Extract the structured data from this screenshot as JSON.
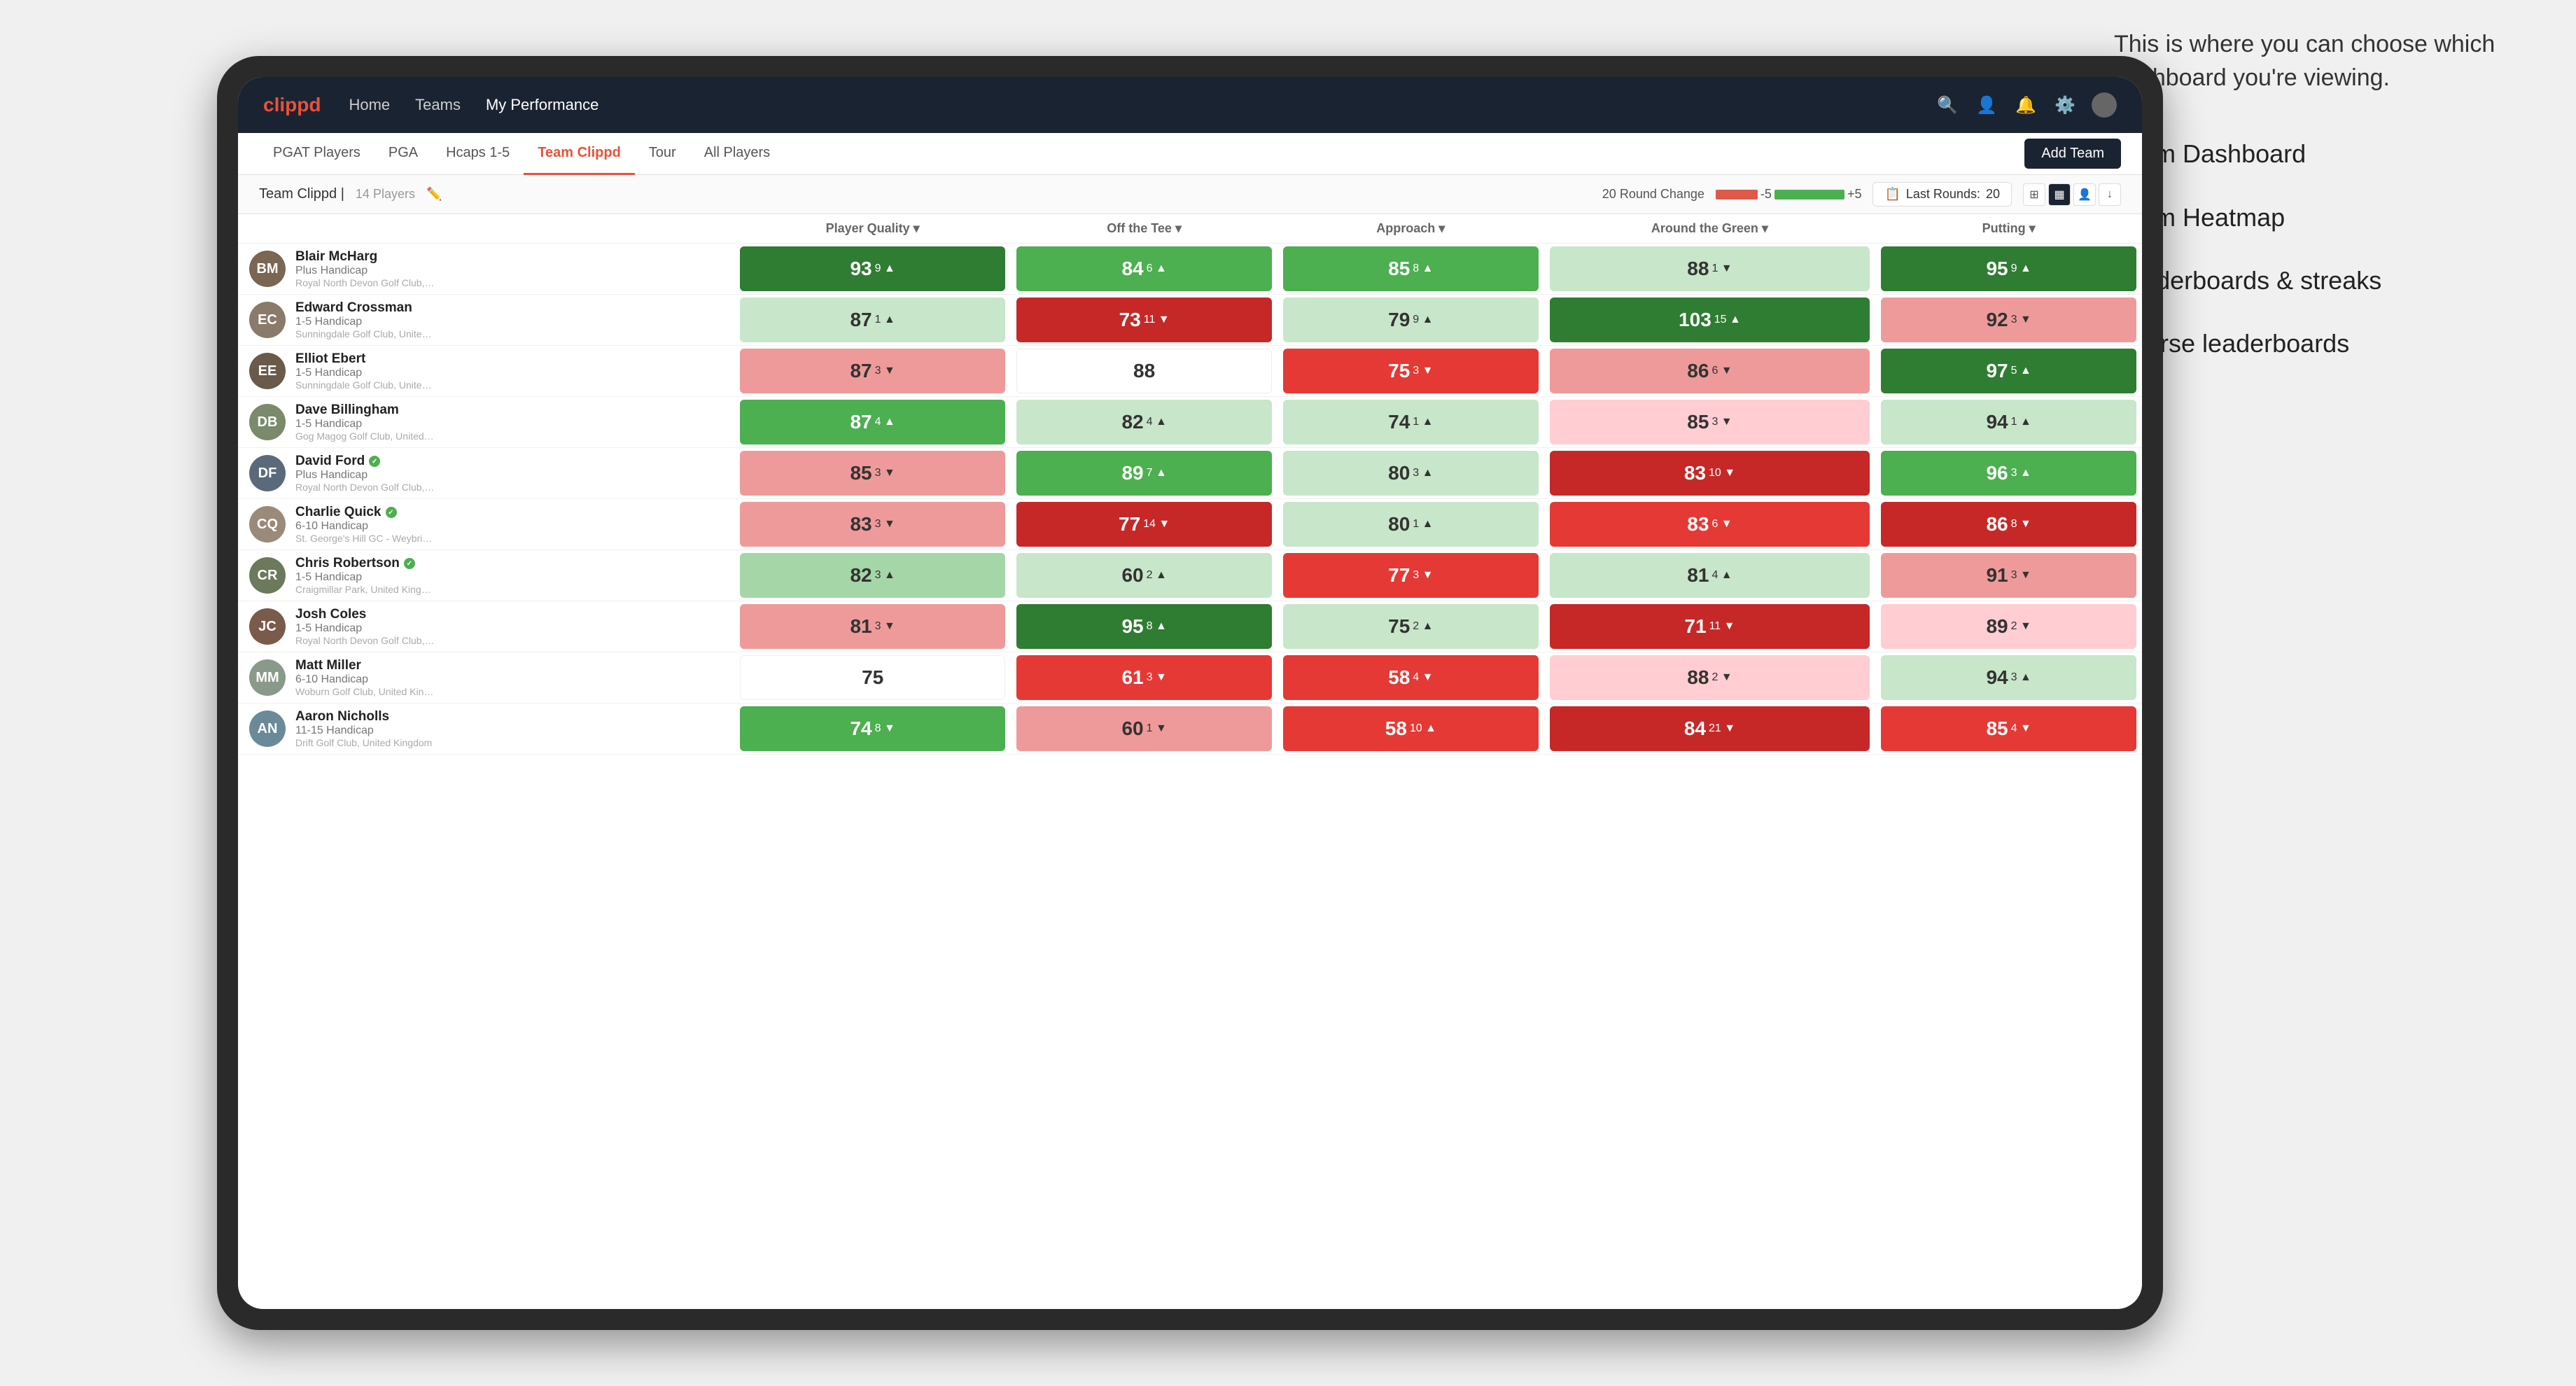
{
  "annotation": {
    "intro": "This is where you can choose which dashboard you're viewing.",
    "items": [
      "Team Dashboard",
      "Team Heatmap",
      "Leaderboards & streaks",
      "Course leaderboards"
    ]
  },
  "nav": {
    "logo": "clippd",
    "links": [
      "Home",
      "Teams",
      "My Performance"
    ],
    "active_link": "My Performance"
  },
  "tabs": {
    "items": [
      "PGAT Players",
      "PGA",
      "Hcaps 1-5",
      "Team Clippd",
      "Tour",
      "All Players"
    ],
    "active": "Team Clippd",
    "add_button": "Add Team"
  },
  "sub_header": {
    "title": "Team Clippd",
    "player_count": "14 Players",
    "round_change_label": "20 Round Change",
    "round_change_minus": "-5",
    "round_change_plus": "+5",
    "last_rounds_label": "Last Rounds:",
    "last_rounds_value": "20"
  },
  "table": {
    "columns": [
      "Player Quality ▾",
      "Off the Tee ▾",
      "Approach ▾",
      "Around the Green ▾",
      "Putting ▾"
    ],
    "rows": [
      {
        "name": "Blair McHarg",
        "handicap": "Plus Handicap",
        "club": "Royal North Devon Golf Club, United Kingdom",
        "avatar_initials": "BM",
        "avatar_color": "#7a6652",
        "metrics": [
          {
            "value": "93",
            "change": "9",
            "dir": "up",
            "bg": "bg-green-dark"
          },
          {
            "value": "84",
            "change": "6",
            "dir": "up",
            "bg": "bg-green-mid"
          },
          {
            "value": "85",
            "change": "8",
            "dir": "up",
            "bg": "bg-green-mid"
          },
          {
            "value": "88",
            "change": "1",
            "dir": "down",
            "bg": "bg-light-green"
          },
          {
            "value": "95",
            "change": "9",
            "dir": "up",
            "bg": "bg-green-dark"
          }
        ]
      },
      {
        "name": "Edward Crossman",
        "handicap": "1-5 Handicap",
        "club": "Sunningdale Golf Club, United Kingdom",
        "avatar_initials": "EC",
        "avatar_color": "#8a7a6a",
        "metrics": [
          {
            "value": "87",
            "change": "1",
            "dir": "up",
            "bg": "bg-light-green"
          },
          {
            "value": "73",
            "change": "11",
            "dir": "down",
            "bg": "bg-red-dark"
          },
          {
            "value": "79",
            "change": "9",
            "dir": "up",
            "bg": "bg-light-green"
          },
          {
            "value": "103",
            "change": "15",
            "dir": "up",
            "bg": "bg-green-dark"
          },
          {
            "value": "92",
            "change": "3",
            "dir": "down",
            "bg": "bg-red-light"
          }
        ]
      },
      {
        "name": "Elliot Ebert",
        "handicap": "1-5 Handicap",
        "club": "Sunningdale Golf Club, United Kingdom",
        "avatar_initials": "EE",
        "avatar_color": "#6a5a4a",
        "metrics": [
          {
            "value": "87",
            "change": "3",
            "dir": "down",
            "bg": "bg-red-light"
          },
          {
            "value": "88",
            "change": "",
            "dir": "",
            "bg": "bg-white"
          },
          {
            "value": "75",
            "change": "3",
            "dir": "down",
            "bg": "bg-red-mid"
          },
          {
            "value": "86",
            "change": "6",
            "dir": "down",
            "bg": "bg-red-light"
          },
          {
            "value": "97",
            "change": "5",
            "dir": "up",
            "bg": "bg-green-dark"
          }
        ]
      },
      {
        "name": "Dave Billingham",
        "handicap": "1-5 Handicap",
        "club": "Gog Magog Golf Club, United Kingdom",
        "avatar_initials": "DB",
        "avatar_color": "#7a8a6a",
        "metrics": [
          {
            "value": "87",
            "change": "4",
            "dir": "up",
            "bg": "bg-green-mid"
          },
          {
            "value": "82",
            "change": "4",
            "dir": "up",
            "bg": "bg-light-green"
          },
          {
            "value": "74",
            "change": "1",
            "dir": "up",
            "bg": "bg-light-green"
          },
          {
            "value": "85",
            "change": "3",
            "dir": "down",
            "bg": "bg-light-red"
          },
          {
            "value": "94",
            "change": "1",
            "dir": "up",
            "bg": "bg-light-green"
          }
        ]
      },
      {
        "name": "David Ford",
        "handicap": "Plus Handicap",
        "club": "Royal North Devon Golf Club, United Kingdom",
        "avatar_initials": "DF",
        "avatar_color": "#5a6a7a",
        "badge": true,
        "metrics": [
          {
            "value": "85",
            "change": "3",
            "dir": "down",
            "bg": "bg-red-light"
          },
          {
            "value": "89",
            "change": "7",
            "dir": "up",
            "bg": "bg-green-mid"
          },
          {
            "value": "80",
            "change": "3",
            "dir": "up",
            "bg": "bg-light-green"
          },
          {
            "value": "83",
            "change": "10",
            "dir": "down",
            "bg": "bg-red-dark"
          },
          {
            "value": "96",
            "change": "3",
            "dir": "up",
            "bg": "bg-green-mid"
          }
        ]
      },
      {
        "name": "Charlie Quick",
        "handicap": "6-10 Handicap",
        "club": "St. George's Hill GC - Weybridge - Surrey, Uni...",
        "avatar_initials": "CQ",
        "avatar_color": "#9a8a7a",
        "badge": true,
        "metrics": [
          {
            "value": "83",
            "change": "3",
            "dir": "down",
            "bg": "bg-red-light"
          },
          {
            "value": "77",
            "change": "14",
            "dir": "down",
            "bg": "bg-red-dark"
          },
          {
            "value": "80",
            "change": "1",
            "dir": "up",
            "bg": "bg-light-green"
          },
          {
            "value": "83",
            "change": "6",
            "dir": "down",
            "bg": "bg-red-mid"
          },
          {
            "value": "86",
            "change": "8",
            "dir": "down",
            "bg": "bg-red-dark"
          }
        ]
      },
      {
        "name": "Chris Robertson",
        "handicap": "1-5 Handicap",
        "club": "Craigmillar Park, United Kingdom",
        "avatar_initials": "CR",
        "avatar_color": "#6a7a5a",
        "badge": true,
        "metrics": [
          {
            "value": "82",
            "change": "3",
            "dir": "up",
            "bg": "bg-green-light"
          },
          {
            "value": "60",
            "change": "2",
            "dir": "up",
            "bg": "bg-light-green"
          },
          {
            "value": "77",
            "change": "3",
            "dir": "down",
            "bg": "bg-red-mid"
          },
          {
            "value": "81",
            "change": "4",
            "dir": "up",
            "bg": "bg-light-green"
          },
          {
            "value": "91",
            "change": "3",
            "dir": "down",
            "bg": "bg-red-light"
          }
        ]
      },
      {
        "name": "Josh Coles",
        "handicap": "1-5 Handicap",
        "club": "Royal North Devon Golf Club, United Kingdom",
        "avatar_initials": "JC",
        "avatar_color": "#7a5a4a",
        "metrics": [
          {
            "value": "81",
            "change": "3",
            "dir": "down",
            "bg": "bg-red-light"
          },
          {
            "value": "95",
            "change": "8",
            "dir": "up",
            "bg": "bg-green-dark"
          },
          {
            "value": "75",
            "change": "2",
            "dir": "up",
            "bg": "bg-light-green"
          },
          {
            "value": "71",
            "change": "11",
            "dir": "down",
            "bg": "bg-red-dark"
          },
          {
            "value": "89",
            "change": "2",
            "dir": "down",
            "bg": "bg-light-red"
          }
        ]
      },
      {
        "name": "Matt Miller",
        "handicap": "6-10 Handicap",
        "club": "Woburn Golf Club, United Kingdom",
        "avatar_initials": "MM",
        "avatar_color": "#8a9a8a",
        "metrics": [
          {
            "value": "75",
            "change": "",
            "dir": "",
            "bg": "bg-white"
          },
          {
            "value": "61",
            "change": "3",
            "dir": "down",
            "bg": "bg-red-mid"
          },
          {
            "value": "58",
            "change": "4",
            "dir": "down",
            "bg": "bg-red-mid"
          },
          {
            "value": "88",
            "change": "2",
            "dir": "down",
            "bg": "bg-light-red"
          },
          {
            "value": "94",
            "change": "3",
            "dir": "up",
            "bg": "bg-light-green"
          }
        ]
      },
      {
        "name": "Aaron Nicholls",
        "handicap": "11-15 Handicap",
        "club": "Drift Golf Club, United Kingdom",
        "avatar_initials": "AN",
        "avatar_color": "#6a8a9a",
        "metrics": [
          {
            "value": "74",
            "change": "8",
            "dir": "down",
            "bg": "bg-green-mid"
          },
          {
            "value": "60",
            "change": "1",
            "dir": "down",
            "bg": "bg-red-light"
          },
          {
            "value": "58",
            "change": "10",
            "dir": "up",
            "bg": "bg-red-mid"
          },
          {
            "value": "84",
            "change": "21",
            "dir": "down",
            "bg": "bg-red-dark"
          },
          {
            "value": "85",
            "change": "4",
            "dir": "down",
            "bg": "bg-red-mid"
          }
        ]
      }
    ]
  }
}
